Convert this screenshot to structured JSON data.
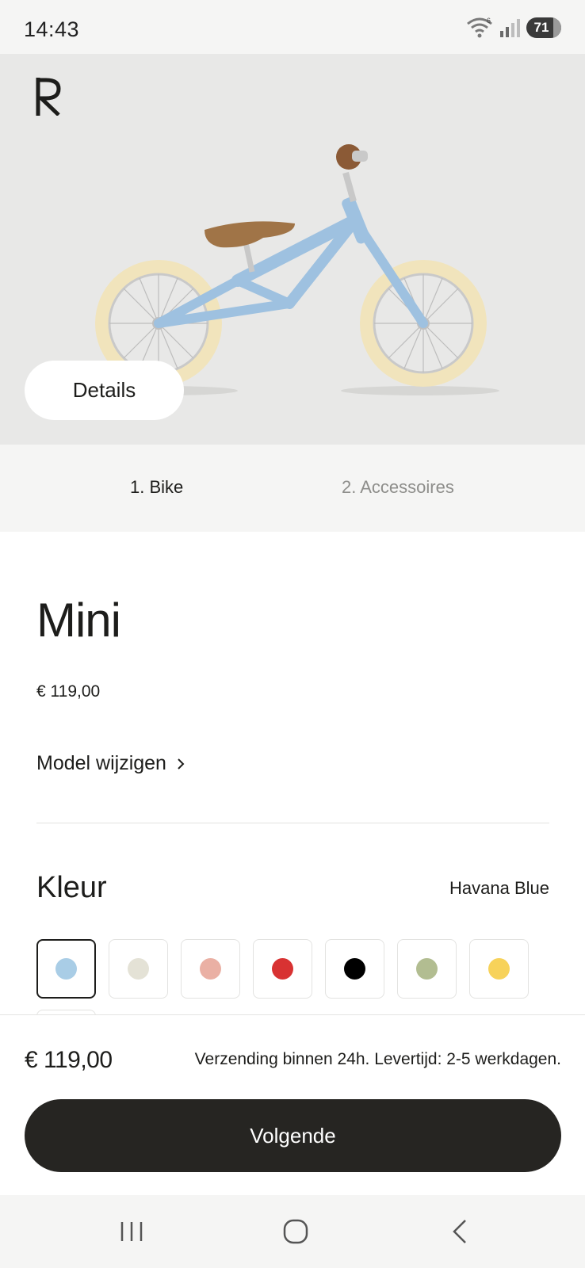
{
  "status_bar": {
    "time": "14:43",
    "battery": "71",
    "icons": [
      "wifi-icon",
      "signal-icon",
      "battery-icon"
    ]
  },
  "hero": {
    "logo_icon": "brand-logo-r",
    "image_name": "balance-bike-image",
    "details_label": "Details"
  },
  "steps": [
    {
      "label": "1. Bike",
      "active": true
    },
    {
      "label": "2. Accessoires",
      "active": false
    }
  ],
  "product": {
    "title": "Mini",
    "price": "€ 119,00",
    "change_model_label": "Model wijzigen"
  },
  "color": {
    "heading": "Kleur",
    "selected_name": "Havana Blue",
    "swatches": [
      {
        "color": "#a9cde6",
        "selected": true
      },
      {
        "color": "#e4e2d6",
        "selected": false
      },
      {
        "color": "#eab0a4",
        "selected": false
      },
      {
        "color": "#d83232",
        "selected": false
      },
      {
        "color": "#000000",
        "selected": false
      },
      {
        "color": "#b2bd91",
        "selected": false
      },
      {
        "color": "#f7d25a",
        "selected": false
      }
    ]
  },
  "footer": {
    "price": "€ 119,00",
    "shipping": "Verzending binnen 24h. Levertijd: 2-5 werkdagen.",
    "next_label": "Volgende"
  },
  "nav_bar": {
    "icons": [
      "recent-apps-icon",
      "home-icon",
      "back-icon"
    ]
  }
}
